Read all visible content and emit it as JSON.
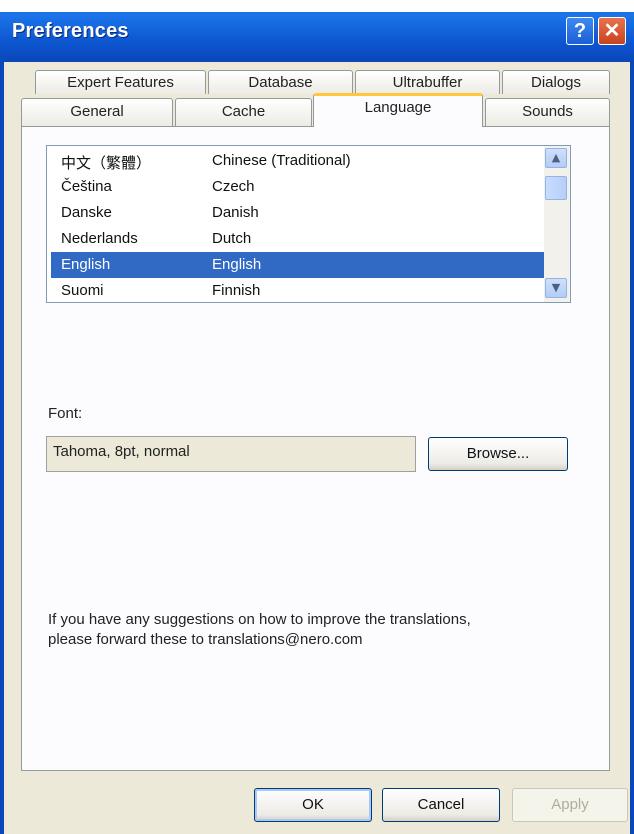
{
  "window": {
    "title": "Preferences",
    "help_glyph": "?",
    "close_glyph": "✕"
  },
  "tabs": {
    "row1": [
      "Expert Features",
      "Database",
      "Ultrabuffer",
      "Dialogs"
    ],
    "row2": [
      "General",
      "Cache",
      "Language",
      "Sounds"
    ],
    "active": "Language"
  },
  "languages": [
    {
      "native": "中文（繁體）",
      "english": "Chinese (Traditional)",
      "selected": false
    },
    {
      "native": "Čeština",
      "english": "Czech",
      "selected": false
    },
    {
      "native": "Danske",
      "english": "Danish",
      "selected": false
    },
    {
      "native": "Nederlands",
      "english": "Dutch",
      "selected": false
    },
    {
      "native": "English",
      "english": "English",
      "selected": true
    },
    {
      "native": "Suomi",
      "english": "Finnish",
      "selected": false
    }
  ],
  "font": {
    "label": "Font:",
    "value": "Tahoma, 8pt, normal",
    "browse_label": "Browse..."
  },
  "suggestion_text_line1": "If you have any suggestions on how to improve the translations,",
  "suggestion_text_line2": "please forward these to translations@nero.com",
  "buttons": {
    "ok": "OK",
    "cancel": "Cancel",
    "apply": "Apply"
  },
  "colors": {
    "selection": "#316ac5",
    "titlebar": "#0a5fd8",
    "active_tab_accent": "#ffc83c"
  }
}
